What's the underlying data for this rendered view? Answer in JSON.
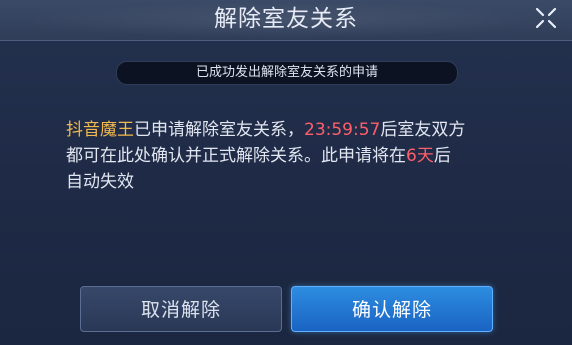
{
  "dialog": {
    "title": "解除室友关系",
    "close_icon": "close-icon"
  },
  "toast": {
    "text": "已成功发出解除室友关系的申请"
  },
  "message": {
    "player_name": "抖音魔王",
    "part1": "已申请解除室友关系，",
    "timer": "23:59:57",
    "part2": "后室友双方都可在此处确认并正式解除关系。此申请将在",
    "days": "6天",
    "part3": "后自动失效"
  },
  "buttons": {
    "cancel_label": "取消解除",
    "confirm_label": "确认解除"
  },
  "colors": {
    "player_name": "#f2b94e",
    "highlight_red": "#ff5f6a",
    "confirm_button": "#1f73d0"
  }
}
